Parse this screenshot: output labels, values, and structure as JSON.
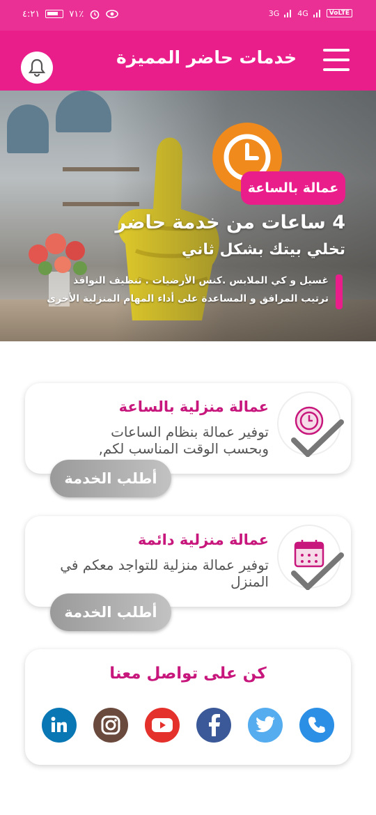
{
  "status_bar": {
    "time": "٤:٢١",
    "battery": "٧١٪",
    "network_labels": [
      "3G",
      "4G"
    ],
    "volte": "VoLTE"
  },
  "app_bar": {
    "title": "خدمات حاضر المميزة",
    "menu_icon": "hamburger-icon",
    "bell_icon": "bell-icon"
  },
  "hero": {
    "tag": "عمالة بالساعة",
    "heading": "4 ساعات من خدمة حاضر",
    "subheading": "تخلي بيتك بشكل ثاني",
    "list_line1": "غسيل و كي الملابس .كنس الأرضيات . تنظيف النوافذ",
    "list_line2": "ترتيب المرافق و المساعدة على أداء المهام المنزلية الأخرى",
    "clock_icon": "clock-icon"
  },
  "services": [
    {
      "title": "عمالة منزلية بالساعة",
      "desc_line1": "توفير عمالة بنظام الساعات",
      "desc_line2": "وبحسب الوقت المناسب لكم,",
      "button": "أطلب الخدمة",
      "icon": "clock-icon"
    },
    {
      "title": "عمالة منزلية دائمة",
      "desc_line1": "توفير عمالة منزلية للتواجد معكم في",
      "desc_line2": "المنزل",
      "button": "أطلب الخدمة",
      "icon": "calendar-icon"
    }
  ],
  "contact": {
    "title": "كن على تواصل معنا",
    "channels": [
      {
        "name": "phone-icon",
        "color": "#2b8fe6"
      },
      {
        "name": "twitter-icon",
        "color": "#55acee"
      },
      {
        "name": "facebook-icon",
        "color": "#3b5998"
      },
      {
        "name": "youtube-icon",
        "color": "#e5312c"
      },
      {
        "name": "instagram-icon",
        "color": "#6b4a3e"
      },
      {
        "name": "linkedin-icon",
        "color": "#0a77b5"
      }
    ]
  },
  "colors": {
    "brand_pink": "#ea1e8b",
    "title_pink": "#c8177c",
    "clock_orange": "#f08a1c"
  }
}
